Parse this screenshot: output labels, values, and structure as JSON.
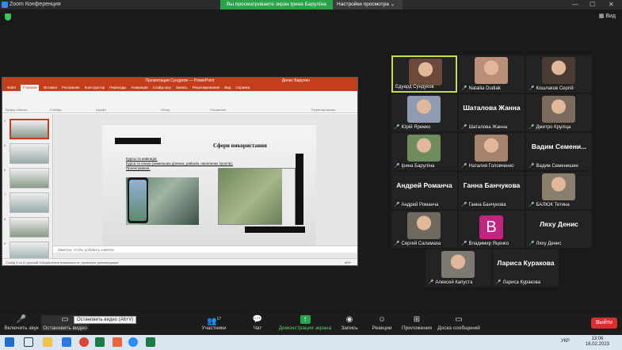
{
  "titlebar": {
    "app_title": "Zoom Конференция",
    "share_banner": "Вы просматриваете экран Ірина Барулїна",
    "view_options": "Настройки просмотра"
  },
  "meeting": {
    "view_label": "Вид"
  },
  "shared_screen": {
    "ppt_title": "Презентация Сундуков — PowerPoint",
    "ppt_user": "Денис Барулин",
    "tabs": [
      "Файл",
      "Главная",
      "Вставка",
      "Рисование",
      "Конструктор",
      "Переходы",
      "Анимация",
      "Слайд-шоу",
      "Запись",
      "Рецензирование",
      "Вид",
      "Справка"
    ],
    "active_tab": "Главная",
    "ribbon_groups": [
      "Буфер обмена",
      "Слайды",
      "Шрифт",
      "Абзац",
      "Рисование",
      "Редактирование"
    ],
    "slide_numbers": [
      "4",
      "5",
      "6",
      "7",
      "8",
      "9"
    ],
    "slide_title": "Сфери використання",
    "slide_lines": [
      "Курсы та навігація;",
      "Курси та плани (земельних ділянок, районів, населених пунктів);",
      "Проектування."
    ],
    "notes_placeholder": "Заметки, чтобы добавить заметки",
    "status": "Слайд 4 из 11   русский   Специальные возможности: проверьте рекомендации",
    "zoom": "65%"
  },
  "participants": [
    {
      "name": "Едуард Сундуков",
      "muted": false,
      "display": "photo",
      "active": true
    },
    {
      "name": "Nataliia Dudiak",
      "muted": true,
      "display": "photo"
    },
    {
      "name": "Кошлаков Сергій",
      "muted": true,
      "display": "photo"
    },
    {
      "name": "Юрій Яремко",
      "muted": true,
      "display": "photo"
    },
    {
      "name": "Шаталова Жанна",
      "muted": true,
      "display": "name",
      "big": "Шаталова Жанна"
    },
    {
      "name": "Дмитро Круліца",
      "muted": true,
      "display": "photo"
    },
    {
      "name": "Ірина Барулїна",
      "muted": true,
      "display": "photo"
    },
    {
      "name": "Наталия Головченко",
      "muted": true,
      "display": "photo"
    },
    {
      "name": "Вадим Семенишин",
      "muted": true,
      "display": "name",
      "big": "Вадим Семени..."
    },
    {
      "name": "Андрей Романча",
      "muted": true,
      "display": "name",
      "big": "Андрей Романча"
    },
    {
      "name": "Ганна Банчукова",
      "muted": true,
      "display": "name",
      "big": "Ганна Банчукова"
    },
    {
      "name": "БАЛЮК Тетяна",
      "muted": true,
      "display": "photo"
    },
    {
      "name": "Сергей Саламаха",
      "muted": true,
      "display": "photo"
    },
    {
      "name": "Владимир Яценко",
      "muted": true,
      "display": "avatar",
      "initial": "В"
    },
    {
      "name": "Ляху Денис",
      "muted": true,
      "display": "name",
      "big": "Ляху Денис"
    },
    {
      "name": "Алексей Капуста",
      "muted": true,
      "display": "photo"
    },
    {
      "name": "Лариса Куракова",
      "muted": true,
      "display": "name",
      "big": "Лариса Куракова"
    }
  ],
  "toolbar": {
    "unmute": "Включить звук",
    "stop_video": "Остановить видео",
    "tooltip": "Остановить видео (Alt+V)",
    "participants": "Участники",
    "participants_count": "17",
    "chat": "Чат",
    "share": "Демонстрация экрана",
    "record": "Запись",
    "reactions": "Реакции",
    "apps": "Приложения",
    "breakout": "Доска сообщений",
    "leave": "Выйти"
  },
  "taskbar": {
    "lang": "УКР",
    "time": "13:06",
    "date": "16.02.2023"
  },
  "colors": {
    "share_green": "#2aa34a",
    "leave_red": "#d3302f",
    "active_border": "#c8d94a",
    "ppt_red": "#c43e1c"
  }
}
